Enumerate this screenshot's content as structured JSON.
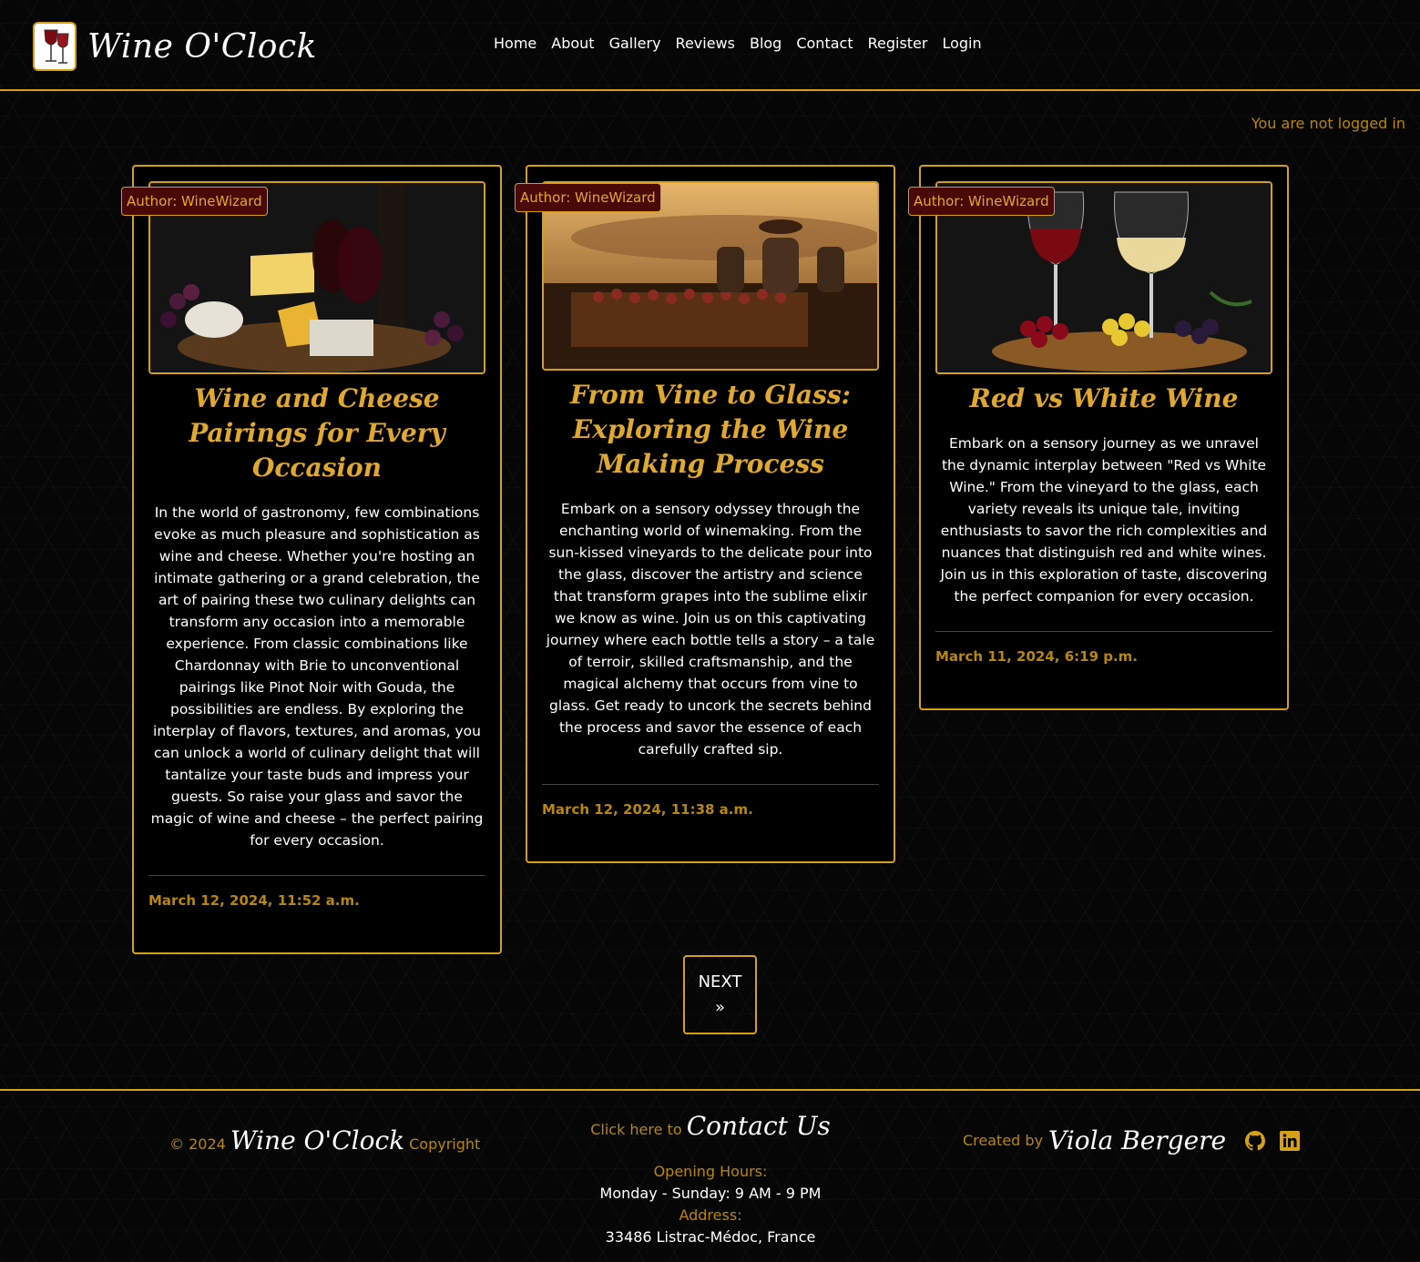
{
  "brand": {
    "name": "Wine O'Clock"
  },
  "nav": {
    "items": [
      {
        "label": "Home"
      },
      {
        "label": "About"
      },
      {
        "label": "Gallery"
      },
      {
        "label": "Reviews"
      },
      {
        "label": "Blog"
      },
      {
        "label": "Contact"
      },
      {
        "label": "Register"
      },
      {
        "label": "Login"
      }
    ]
  },
  "status": {
    "text": "You are not logged in"
  },
  "posts": [
    {
      "author": "Author: WineWizard",
      "title": "Wine and Cheese Pairings for Every Occasion",
      "excerpt": "In the world of gastronomy, few combinations evoke as much pleasure and sophistication as wine and cheese. Whether you're hosting an intimate gathering or a grand celebration, the art of pairing these two culinary delights can transform any occasion into a memorable experience. From classic combinations like Chardonnay with Brie to unconventional pairings like Pinot Noir with Gouda, the possibilities are endless. By exploring the interplay of flavors, textures, and aromas, you can unlock a world of culinary delight that will tantalize your taste buds and impress your guests. So raise your glass and savor the magic of wine and cheese – the perfect pairing for every occasion.",
      "date": "March 12, 2024, 11:52 a.m.",
      "image": "wine-and-cheese-photo"
    },
    {
      "author": "Author: WineWizard",
      "title": "From Vine to Glass: Exploring the Wine Making Process",
      "excerpt": "Embark on a sensory odyssey through the enchanting world of winemaking. From the sun-kissed vineyards to the delicate pour into the glass, discover the artistry and science that transform grapes into the sublime elixir we know as wine. Join us on this captivating journey where each bottle tells a story – a tale of terroir, skilled craftsmanship, and the magical alchemy that occurs from vine to glass. Get ready to uncork the secrets behind the process and savor the essence of each carefully crafted sip.",
      "date": "March 12, 2024, 11:38 a.m.",
      "image": "vineyard-harvest-photo"
    },
    {
      "author": "Author: WineWizard",
      "title": "Red vs White Wine",
      "excerpt": "Embark on a sensory journey as we unravel the dynamic interplay between \"Red vs White Wine.\" From the vineyard to the glass, each variety reveals its unique tale, inviting enthusiasts to savor the rich complexities and nuances that distinguish red and white wines. Join us in this exploration of taste, discovering the perfect companion for every occasion.",
      "date": "March 11, 2024, 6:19 p.m.",
      "image": "red-and-white-wine-photo"
    }
  ],
  "pagination": {
    "next": "NEXT",
    "next_arrow": "»"
  },
  "footer": {
    "copyright_prefix": "© 2024",
    "brand": "Wine O'Clock",
    "copyright_suffix": "Copyright",
    "contact_prefix": "Click here to",
    "contact_link": "Contact Us",
    "hours_label": "Opening Hours:",
    "hours_value": "Monday - Sunday: 9 AM - 9 PM",
    "address_label": "Address:",
    "address_value": "33486 Listrac-Médoc, France",
    "created_prefix": "Created by",
    "creator": "Viola Bergere",
    "icons": [
      "github-icon",
      "linkedin-icon"
    ]
  },
  "colors": {
    "accent": "#d4a017",
    "badge_bg": "#4a0808",
    "background": "#060606"
  }
}
